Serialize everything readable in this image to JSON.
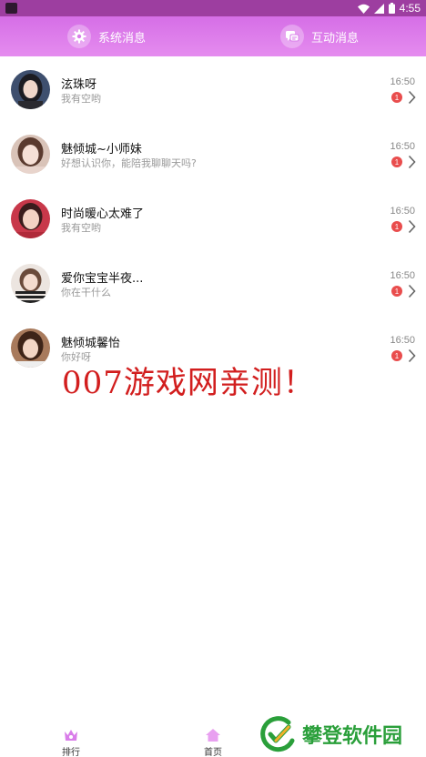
{
  "status_bar": {
    "time": "4:55",
    "icons": [
      "wifi-icon",
      "signal-icon",
      "battery-icon"
    ]
  },
  "header": {
    "tabs": [
      {
        "label": "系统消息",
        "icon": "gear-icon"
      },
      {
        "label": "互动消息",
        "icon": "chat-icon"
      }
    ],
    "gradient": [
      "#d56ee6",
      "#e58cef"
    ]
  },
  "messages": [
    {
      "name": "泫珠呀",
      "preview": "我有空哟",
      "time": "16:50",
      "unread": "1"
    },
    {
      "name": "魅倾城~小师妹",
      "preview": "好想认识你，能陪我聊聊天吗?",
      "time": "16:50",
      "unread": "1"
    },
    {
      "name": "时尚暖心太难了",
      "preview": "我有空哟",
      "time": "16:50",
      "unread": "1"
    },
    {
      "name": "爱你宝宝半夜...",
      "preview": "你在干什么",
      "time": "16:50",
      "unread": "1"
    },
    {
      "name": "魅倾城馨怡",
      "preview": "你好呀",
      "time": "16:50",
      "unread": "1"
    }
  ],
  "overlay": {
    "watermark": "007游戏网亲测！",
    "site_logo": "攀登软件园"
  },
  "bottom_nav": {
    "items": [
      {
        "label": "排行",
        "icon": "ranking-icon"
      },
      {
        "label": "首页",
        "icon": "home-icon"
      }
    ]
  },
  "colors": {
    "accent": "#d56ee6",
    "badge": "#e94d4d",
    "watermark": "#d21e1e",
    "logo": "#2a9f3a"
  }
}
